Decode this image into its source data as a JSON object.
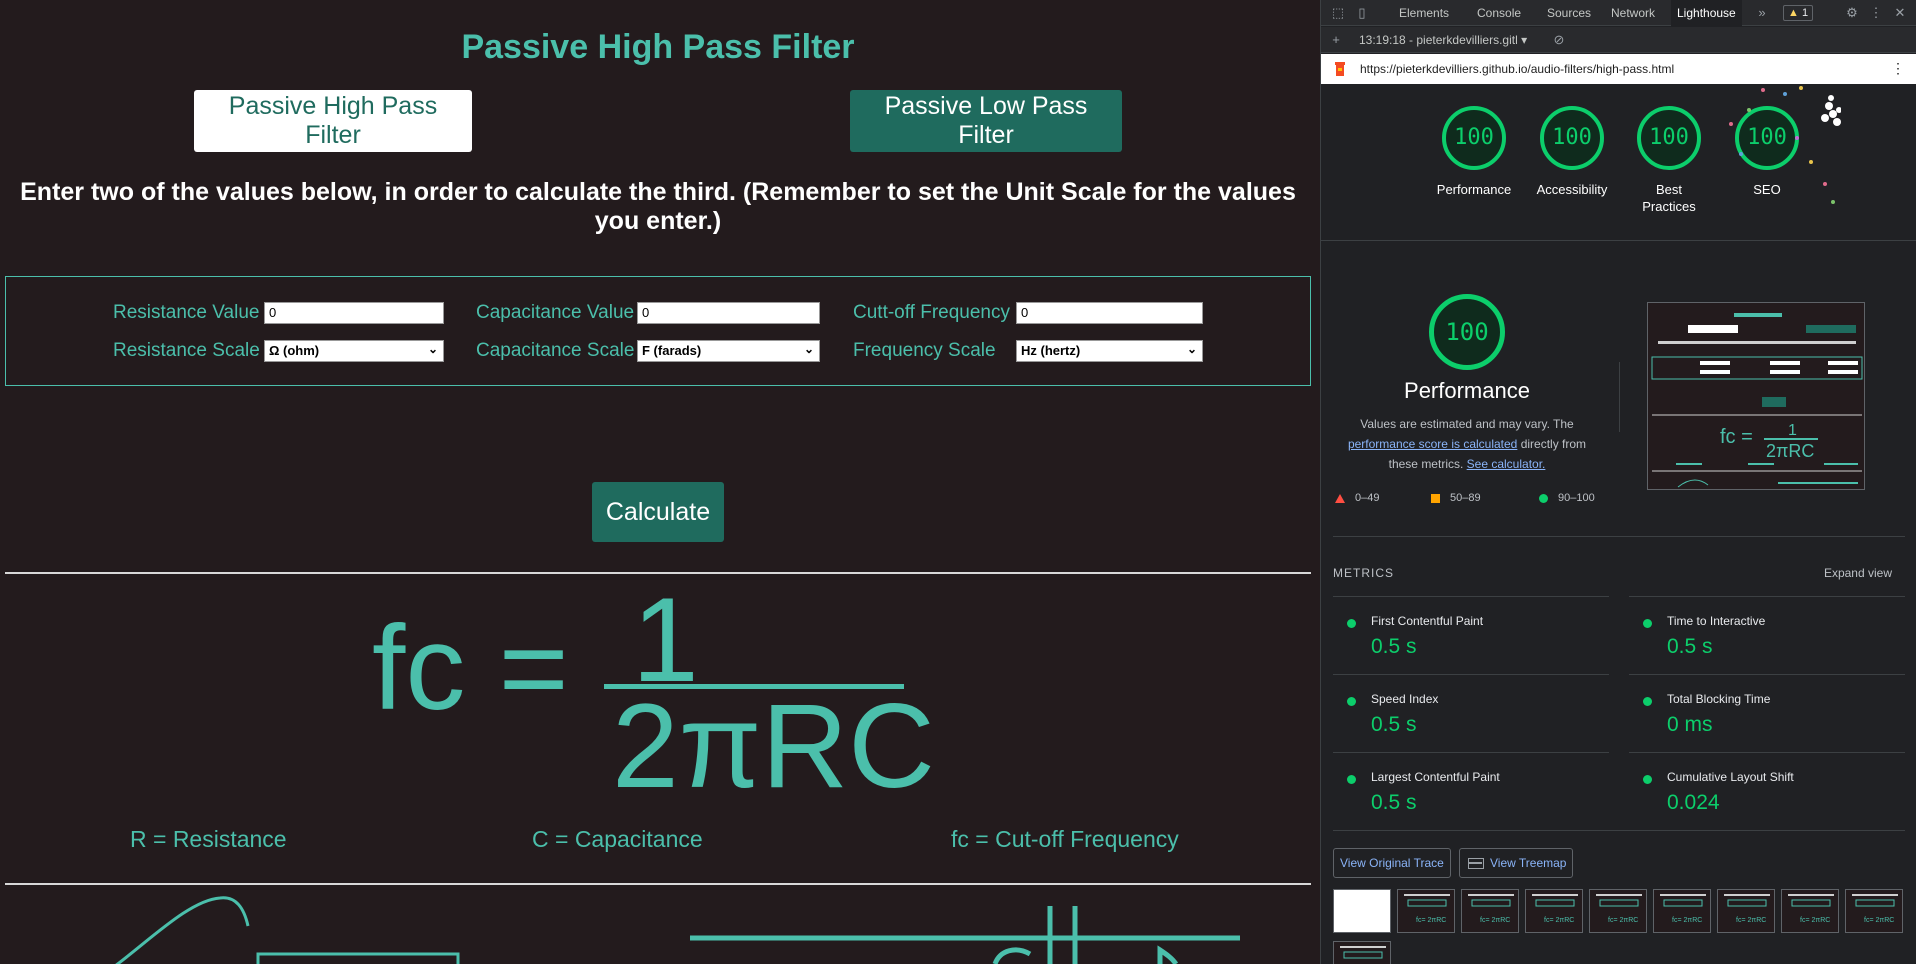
{
  "app": {
    "title": "Passive High Pass Filter",
    "nav": {
      "high_pass": "Passive High Pass Filter",
      "low_pass": "Passive Low Pass Filter"
    },
    "instructions": "Enter two of the values below, in order to calculate the third. (Remember to set the Unit Scale for the values you enter.)",
    "form": {
      "resistance_value_label": "Resistance Value",
      "resistance_value": "0",
      "resistance_scale_label": "Resistance Scale",
      "resistance_scale": "Ω (ohm)",
      "capacitance_value_label": "Capacitance Value",
      "capacitance_value": "0",
      "capacitance_scale_label": "Capacitance Scale",
      "capacitance_scale": "F (farads)",
      "cutoff_label": "Cutt-off Frequency",
      "cutoff_value": "0",
      "frequency_scale_label": "Frequency Scale",
      "frequency_scale": "Hz (hertz)"
    },
    "calculate_label": "Calculate",
    "formula": {
      "lhs": "fc =",
      "numerator": "1",
      "denominator": "2πRC"
    },
    "legend": {
      "r": "R = Resistance",
      "c": "C = Capacitance",
      "fc": "fc = Cut-off Frequency"
    }
  },
  "devtools": {
    "tabs": [
      "Elements",
      "Console",
      "Sources",
      "Network",
      "Lighthouse"
    ],
    "active_tab": "Lighthouse",
    "warning_count": "1",
    "report_selector": "13:19:18 - pieterkdevilliers.gitl",
    "url": "https://pieterkdevilliers.github.io/audio-filters/high-pass.html",
    "scores": [
      {
        "label": "Performance",
        "value": "100"
      },
      {
        "label": "Accessibility",
        "value": "100"
      },
      {
        "label": "Best Practices",
        "value": "100"
      },
      {
        "label": "SEO",
        "value": "100"
      }
    ],
    "performance": {
      "score": "100",
      "title": "Performance",
      "note_start": "Values are estimated and may vary. The ",
      "note_link": "performance score is calculated",
      "note_mid": " directly from these metrics. ",
      "note_link2": "See calculator.",
      "legend": {
        "fail": "0–49",
        "average": "50–89",
        "pass": "90–100"
      }
    },
    "metrics_header": "METRICS",
    "expand_view": "Expand view",
    "metrics": [
      {
        "name": "First Contentful Paint",
        "value": "0.5 s"
      },
      {
        "name": "Time to Interactive",
        "value": "0.5 s"
      },
      {
        "name": "Speed Index",
        "value": "0.5 s"
      },
      {
        "name": "Total Blocking Time",
        "value": "0 ms"
      },
      {
        "name": "Largest Contentful Paint",
        "value": "0.5 s"
      },
      {
        "name": "Cumulative Layout Shift",
        "value": "0.024"
      }
    ],
    "view_trace": "View Original Trace",
    "view_treemap": "View Treemap",
    "colors": {
      "pass": "#0cce6b",
      "average": "#ffa400",
      "fail": "#ff4e42"
    }
  }
}
